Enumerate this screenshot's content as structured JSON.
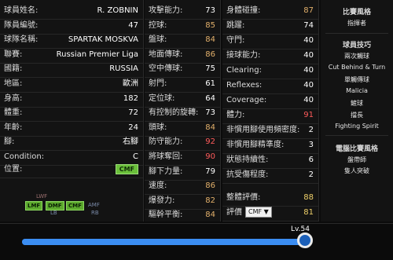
{
  "profile": [
    {
      "label": "球員姓名:",
      "value": "R. ZOBNIN"
    },
    {
      "label": "隊員編號:",
      "value": "47"
    },
    {
      "label": "球隊名稱:",
      "value": "SPARTAK MOSKVA"
    },
    {
      "label": "聯賽:",
      "value": "Russian Premier Liga"
    },
    {
      "label": "國籍:",
      "value": "RUSSIA"
    },
    {
      "label": "地區:",
      "value": "歐洲"
    },
    {
      "label": "身高:",
      "value": "182"
    },
    {
      "label": "體重:",
      "value": "72"
    },
    {
      "label": "年齡:",
      "value": "24"
    },
    {
      "label": "腳:",
      "value": "右腳"
    },
    {
      "label": "Condition:",
      "value": "C"
    }
  ],
  "position": {
    "label": "位置:",
    "value": "CMF"
  },
  "positions_map": {
    "lwf": "LWF",
    "lmf": "LMF",
    "dmf": "DMF",
    "cmf": "CMF",
    "amf": "AMF",
    "lb": "LB",
    "rb": "RB"
  },
  "attributes": [
    {
      "label": "攻擊能力:",
      "value": "73"
    },
    {
      "label": "控球:",
      "value": "85"
    },
    {
      "label": "盤球:",
      "value": "84"
    },
    {
      "label": "地面傳球:",
      "value": "86"
    },
    {
      "label": "空中傳球:",
      "value": "75"
    },
    {
      "label": "射門:",
      "value": "61"
    },
    {
      "label": "定位球:",
      "value": "64"
    },
    {
      "label": "有控制的旋轉:",
      "value": "73"
    },
    {
      "label": "頭球:",
      "value": "84"
    },
    {
      "label": "防守能力:",
      "value": "92"
    },
    {
      "label": "將球奪回:",
      "value": "90"
    },
    {
      "label": "腳下力量:",
      "value": "79"
    },
    {
      "label": "速度:",
      "value": "86"
    },
    {
      "label": "爆發力:",
      "value": "82"
    },
    {
      "label": "驅幹平衡:",
      "value": "84"
    }
  ],
  "attributes_gk": [
    {
      "label": "身體碰撞:",
      "value": "87"
    },
    {
      "label": "跳躍:",
      "value": "74"
    },
    {
      "label": "守門:",
      "value": "40"
    },
    {
      "label": "接球能力:",
      "value": "40"
    },
    {
      "label": "Clearing:",
      "value": "40"
    },
    {
      "label": "Reflexes:",
      "value": "40"
    },
    {
      "label": "Coverage:",
      "value": "40"
    },
    {
      "label": "體力:",
      "value": "91"
    },
    {
      "label": "非慣用腳使用頻密度:",
      "value": "2"
    },
    {
      "label": "非慣用腳精準度:",
      "value": "3"
    },
    {
      "label": "狀態持續性:",
      "value": "6"
    },
    {
      "label": "抗受傷程度:",
      "value": "2"
    }
  ],
  "overall": {
    "label": "整體評價:",
    "value": "88"
  },
  "rating": {
    "label": "評價",
    "position": "CMF ▼",
    "value": "81"
  },
  "side": {
    "style_title": "比賽風格",
    "style_value": "指揮者",
    "skills_title": "球員技巧",
    "skills": [
      "兩次觸球",
      "Cut Behind & Turn",
      "單觸傳球",
      "Malicia",
      "鏟球",
      "擋長",
      "Fighting Spirit"
    ],
    "ai_title": "電腦比賽風格",
    "ai": [
      "盤帶師",
      "隻人突破"
    ]
  },
  "level": {
    "label": "Lv.54",
    "fraction": 1.0
  },
  "colors": {
    "accent": "#6abf3a",
    "slider": "#1d6fd6",
    "high": "#ff5b5b",
    "mid": "#e2b06b",
    "top": "#f0d16a"
  }
}
